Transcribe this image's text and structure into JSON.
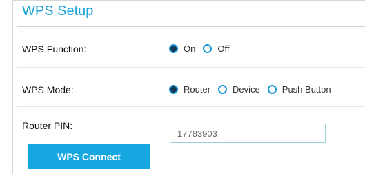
{
  "section": {
    "title": "WPS Setup"
  },
  "function_row": {
    "label": "WPS Function:",
    "options": [
      {
        "label": "On",
        "selected": true
      },
      {
        "label": "Off",
        "selected": false
      }
    ]
  },
  "mode_row": {
    "label": "WPS Mode:",
    "options": [
      {
        "label": "Router",
        "selected": true
      },
      {
        "label": "Device",
        "selected": false
      },
      {
        "label": "Push Button",
        "selected": false
      }
    ]
  },
  "pin_row": {
    "label": "Router PIN:",
    "value": "17783903"
  },
  "connect_button": {
    "label": "WPS Connect"
  },
  "colors": {
    "accent": "#1aa3d9",
    "button": "#17a7e0",
    "radio_selected_fill": "#123a58"
  }
}
